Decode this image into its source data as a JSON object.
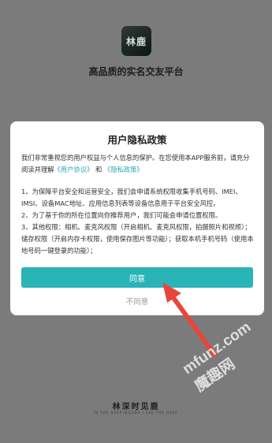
{
  "app": {
    "logo_text": "林鹿",
    "tagline": "高品质的实名交友平台"
  },
  "dialog": {
    "title": "用户隐私政策",
    "intro_before": "我们非常重视您的用户权益与个人信息的保护。在您使用本APP服务前，请充分阅读并理解",
    "link_user_agreement": "《用户协议》",
    "conj": "和",
    "link_privacy_policy": "《隐私政策》",
    "rules": [
      "1、为保障平台安全和运营安全，我们会申请系统权限收集手机号码、IMEI、IMSI、设备MAC地址、应用信息列表等设备信息用于平台安全风控。",
      "2、为了基于你的所在位置向你推荐用户，我们可能会申请位置权限。",
      "3、其他权限：相机、麦克风权限（开启相机、麦克风权限，拍摄照片和视频）；储存权限（开启内存卡权限，使用保存图片等功能）；获取本机手机号码（使用本地号码一键登录的功能）；"
    ],
    "agree_label": "同意",
    "disagree_label": "不同意"
  },
  "watermark": "mfunz.com 魔趣网",
  "footer": {
    "brand": "林深时见鹿",
    "subtitle": "IN THE DEEP WOODS I SEE THE DEER"
  },
  "colors": {
    "accent": "#2ab4b7",
    "link": "#2aa7b3",
    "arrow": "#e8453c"
  }
}
